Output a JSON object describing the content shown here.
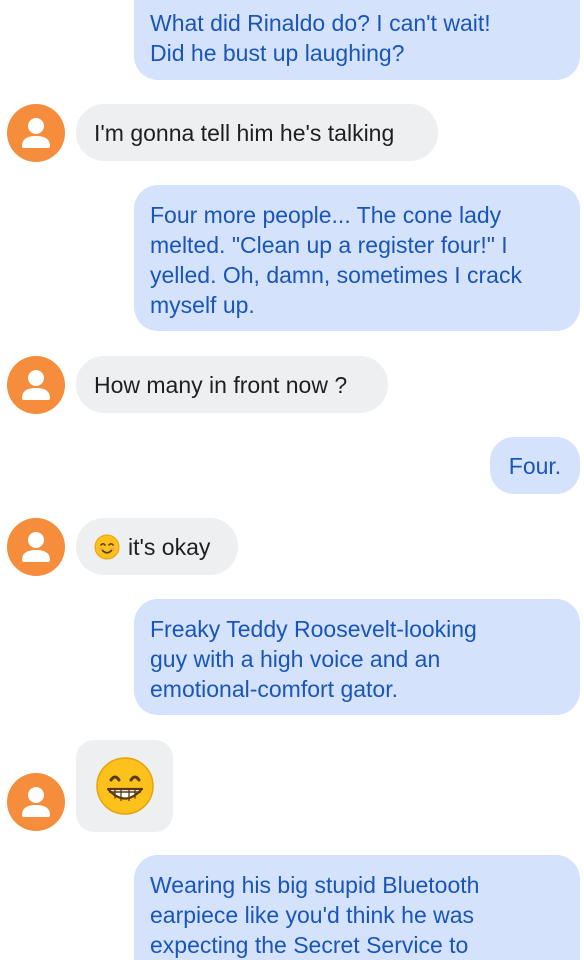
{
  "messages": [
    {
      "id": "m1",
      "direction": "sent",
      "text": "What did Rinaldo do?  I can't wait!\nDid he bust up laughing?"
    },
    {
      "id": "m2",
      "direction": "received",
      "text": "I'm gonna tell him he's talking"
    },
    {
      "id": "m3",
      "direction": "sent",
      "text": "Four more people...  The cone lady\nmelted.  \"Clean up a register four!\" I\nyelled.  Oh, damn, sometimes I crack\nmyself up."
    },
    {
      "id": "m4",
      "direction": "received",
      "text": "How many in front now ?"
    },
    {
      "id": "m5",
      "direction": "sent",
      "text": "Four."
    },
    {
      "id": "m6",
      "direction": "received",
      "emoji": "smiling-face-icon",
      "text": "it's okay"
    },
    {
      "id": "m7",
      "direction": "sent",
      "text": "Freaky Teddy Roosevelt-looking\nguy with a high voice and an\nemotional-comfort gator."
    },
    {
      "id": "m8",
      "direction": "received",
      "emoji": "grinning-face-icon",
      "text": ""
    },
    {
      "id": "m9",
      "direction": "sent",
      "text": "Wearing his big stupid Bluetooth\nearpiece like you'd think he was\nexpecting the Secret Service to"
    }
  ],
  "colors": {
    "sent_bubble": "#d4e2fb",
    "sent_text": "#1a56b9",
    "received_bubble": "#eeeff1",
    "received_text": "#1f1f1f",
    "avatar": "#f58d3d"
  }
}
